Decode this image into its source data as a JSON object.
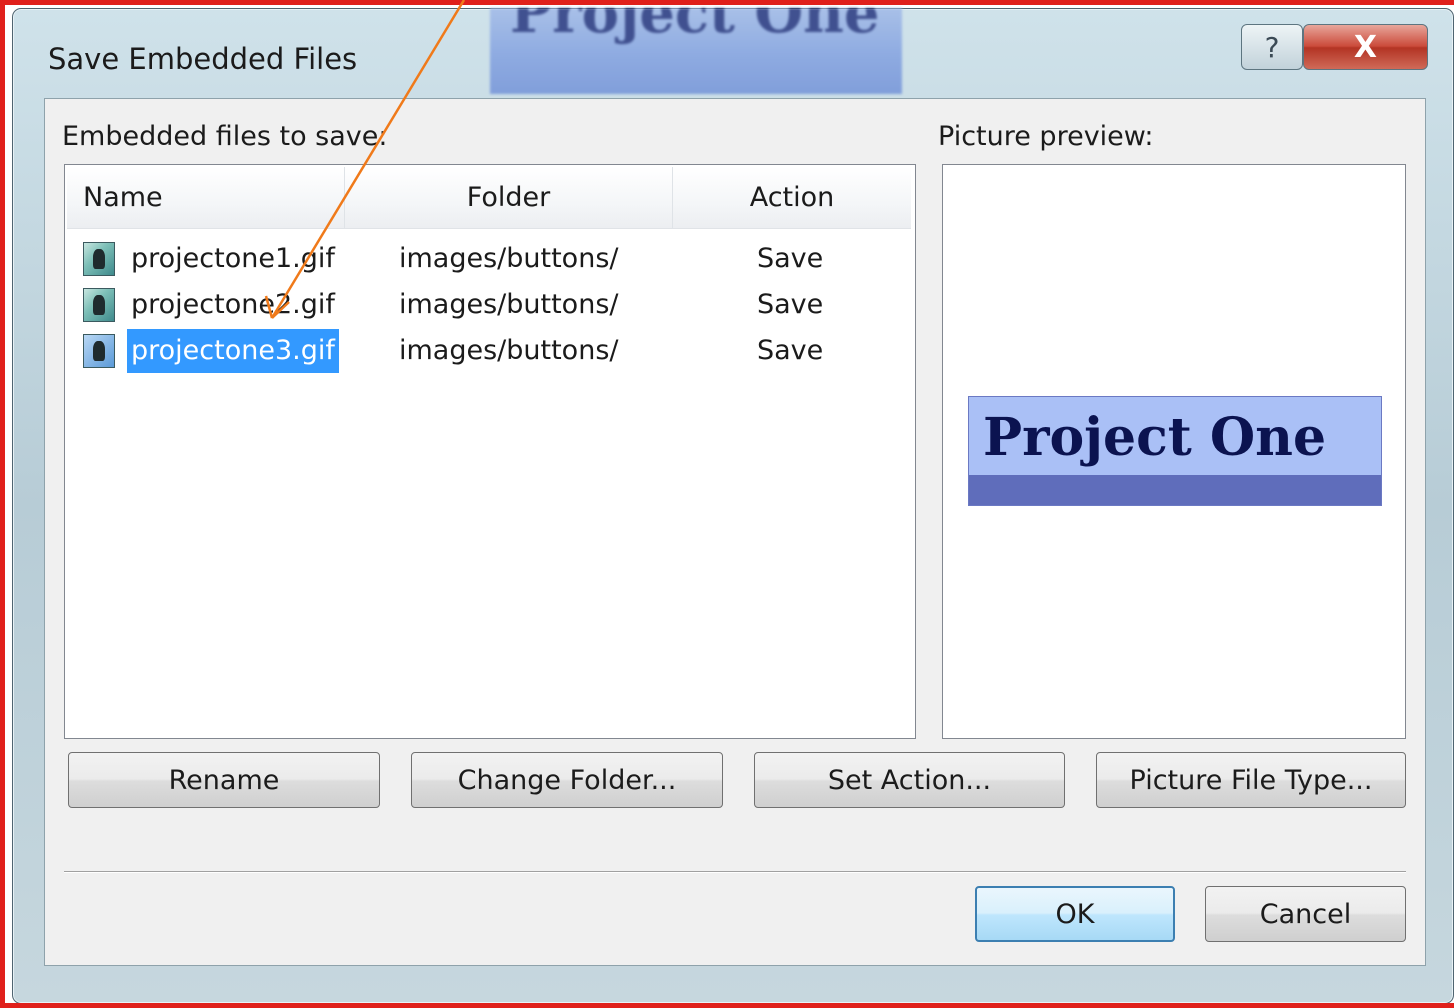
{
  "window": {
    "title": "Save Embedded Files",
    "thumbnail_text": "Project One",
    "help_label": "?",
    "close_label": "X"
  },
  "files_panel": {
    "label": "Embedded files to save:",
    "columns": {
      "name": "Name",
      "folder": "Folder",
      "action": "Action"
    },
    "rows": [
      {
        "name": "projectone1.gif",
        "folder": "images/buttons/",
        "action": "Save",
        "selected": false
      },
      {
        "name": "projectone2.gif",
        "folder": "images/buttons/",
        "action": "Save",
        "selected": false
      },
      {
        "name": "projectone3.gif",
        "folder": "images/buttons/",
        "action": "Save",
        "selected": true
      }
    ]
  },
  "preview_panel": {
    "label": "Picture preview:",
    "image_text": "Project One"
  },
  "buttons": {
    "rename": "Rename",
    "change_folder": "Change Folder...",
    "set_action": "Set Action...",
    "picture_file_type": "Picture File Type...",
    "ok": "OK",
    "cancel": "Cancel"
  },
  "colors": {
    "selection": "#3399ff",
    "annotation_arrow": "#f07a1a",
    "frame_border": "#e0201b"
  }
}
